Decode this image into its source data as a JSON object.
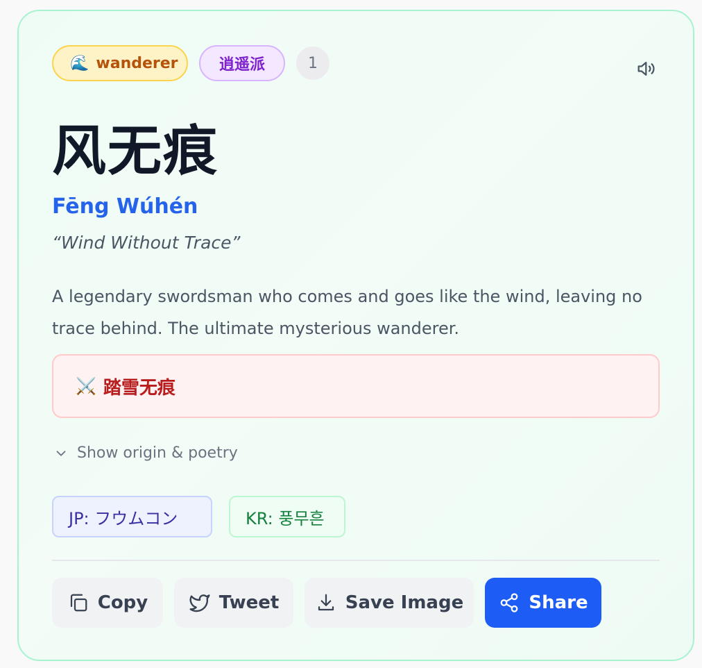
{
  "badges": {
    "type_emoji": "🌊",
    "type_label": "wanderer",
    "school_label": "逍遥派",
    "count": "1"
  },
  "name": {
    "hanzi": "风无痕",
    "pinyin": "Fēng Wúhén",
    "meaning": "“Wind Without Trace”",
    "description": "A legendary swordsman who comes and goes like the wind, leaving no trace behind. The ultimate mysterious wanderer."
  },
  "skill": {
    "icon": "⚔️",
    "name": "踏雪无痕"
  },
  "origin_toggle_label": "Show origin & poetry",
  "transliterations": {
    "jp": "JP: フウムコン",
    "kr": "KR: 풍무흔"
  },
  "actions": {
    "copy": "Copy",
    "tweet": "Tweet",
    "save_image": "Save Image",
    "share": "Share"
  },
  "colors": {
    "accent": "#1d5cf5",
    "card_border": "#a7f3d0",
    "pinyin": "#2563eb",
    "skill_text": "#b91c1c"
  }
}
